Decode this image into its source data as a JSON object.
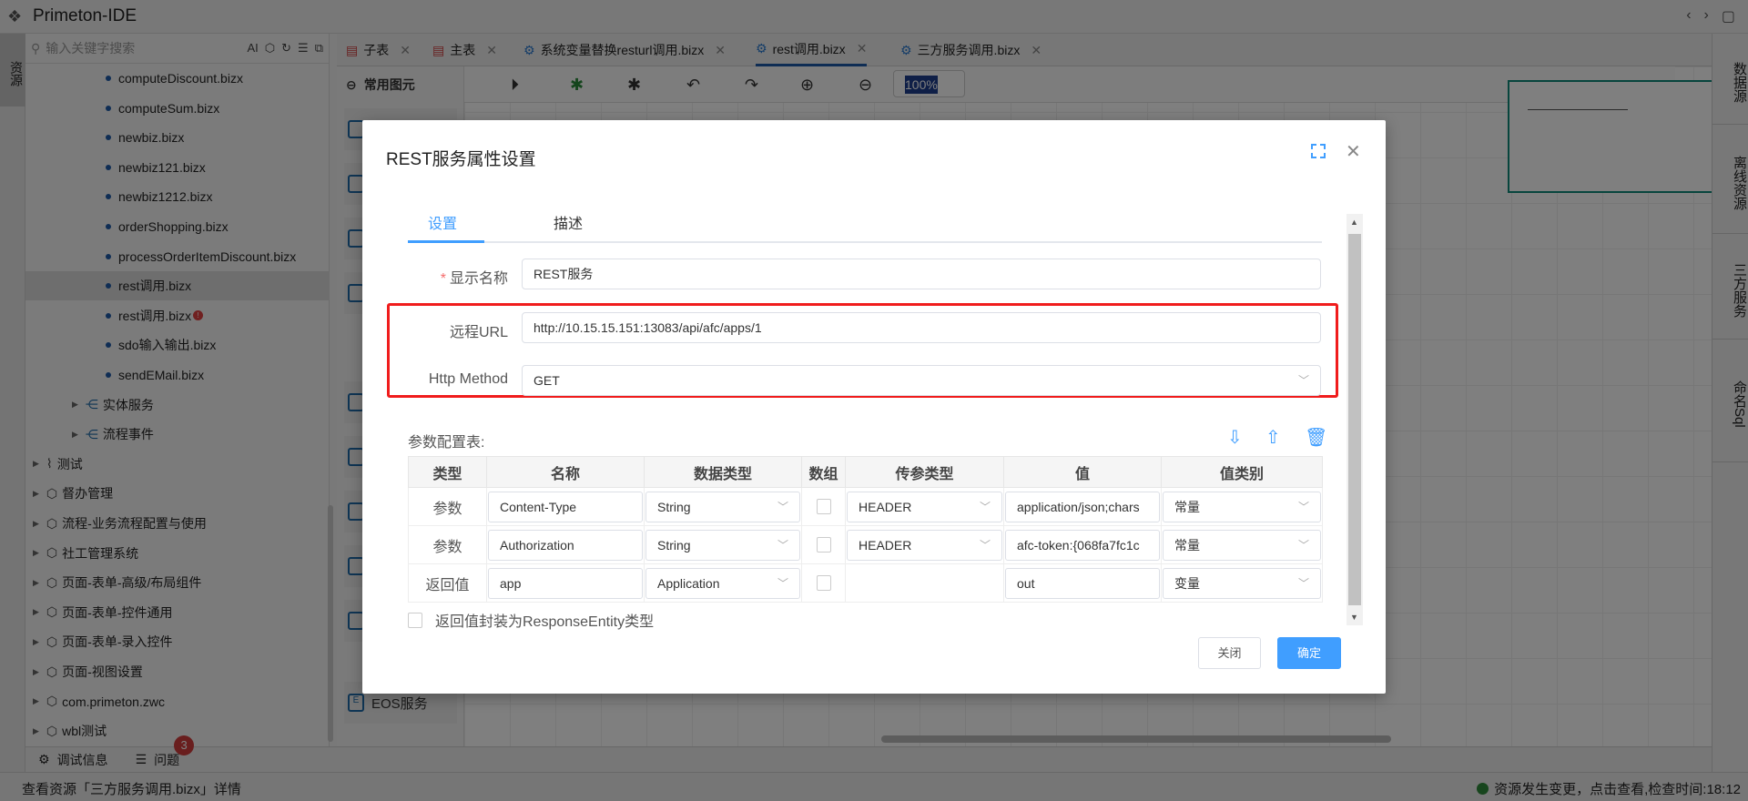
{
  "app": {
    "title": "Primeton-IDE"
  },
  "left_strip": {
    "label": "资源"
  },
  "sidebar": {
    "search_placeholder": "输入关键字搜索",
    "tools": [
      "AI",
      "⬡",
      "↻",
      "☰",
      "⧉"
    ],
    "items": [
      {
        "label": "computeDiscount.bizx",
        "level": 2,
        "kind": "file"
      },
      {
        "label": "computeSum.bizx",
        "level": 2,
        "kind": "file"
      },
      {
        "label": "newbiz.bizx",
        "level": 2,
        "kind": "file"
      },
      {
        "label": "newbiz121.bizx",
        "level": 2,
        "kind": "file"
      },
      {
        "label": "newbiz1212.bizx",
        "level": 2,
        "kind": "file"
      },
      {
        "label": "orderShopping.bizx",
        "level": 2,
        "kind": "file"
      },
      {
        "label": "processOrderItemDiscount.bizx",
        "level": 2,
        "kind": "file"
      },
      {
        "label": "rest调用.bizx",
        "level": 2,
        "kind": "file",
        "selected": true
      },
      {
        "label": "rest调用.bizx",
        "level": 2,
        "kind": "file",
        "error": "!"
      },
      {
        "label": "sdo输入输出.bizx",
        "level": 2,
        "kind": "file"
      },
      {
        "label": "sendEMail.bizx",
        "level": 2,
        "kind": "file"
      },
      {
        "label": "实体服务",
        "level": 1,
        "kind": "group"
      },
      {
        "label": "流程事件",
        "level": 1,
        "kind": "group"
      },
      {
        "label": "测试",
        "level": 0,
        "kind": "test"
      },
      {
        "label": "督办管理",
        "level": 0,
        "kind": "pkg"
      },
      {
        "label": "流程-业务流程配置与使用",
        "level": 0,
        "kind": "pkg"
      },
      {
        "label": "社工管理系统",
        "level": 0,
        "kind": "pkg"
      },
      {
        "label": "页面-表单-高级/布局组件",
        "level": 0,
        "kind": "pkg"
      },
      {
        "label": "页面-表单-控件通用",
        "level": 0,
        "kind": "pkg"
      },
      {
        "label": "页面-表单-录入控件",
        "level": 0,
        "kind": "pkg"
      },
      {
        "label": "页面-视图设置",
        "level": 0,
        "kind": "pkg"
      },
      {
        "label": "com.primeton.zwc",
        "level": 0,
        "kind": "pkg"
      },
      {
        "label": "wbl测试",
        "level": 0,
        "kind": "pkg"
      }
    ]
  },
  "tabs": [
    {
      "label": "子表",
      "icon": "form-icon"
    },
    {
      "label": "主表",
      "icon": "form-icon"
    },
    {
      "label": "系统变量替换resturl调用.bizx",
      "icon": "gear-icon"
    },
    {
      "label": "rest调用.bizx",
      "icon": "gear-icon",
      "active": true
    },
    {
      "label": "三方服务调用.bizx",
      "icon": "gear-icon"
    }
  ],
  "palette": {
    "header": "常用图元",
    "eos": "EOS服务"
  },
  "toolbar": {
    "zoom": "100%"
  },
  "right_strip": [
    "数据源",
    "离线资源",
    "三方服务",
    "命名Sql"
  ],
  "bottom": {
    "debug": "调试信息",
    "problems": "问题",
    "problems_count": "3"
  },
  "status": {
    "left": "查看资源「三方服务调用.bizx」详情",
    "right": "资源发生变更，点击查看,检查时间:18:12"
  },
  "modal": {
    "title": "REST服务属性设置",
    "tabs": [
      "设置",
      "描述"
    ],
    "display_name_label": "显示名称",
    "display_name": "REST服务",
    "url_label": "远程URL",
    "url": "http://10.15.15.151:13083/api/afc/apps/1",
    "method_label": "Http Method",
    "method": "GET",
    "params_title": "参数配置表:",
    "columns": [
      "类型",
      "名称",
      "数据类型",
      "数组",
      "传参类型",
      "值",
      "值类别"
    ],
    "rows": [
      {
        "type": "参数",
        "name": "Content-Type",
        "dtype": "String",
        "pass": "HEADER",
        "value": "application/json;chars",
        "vtype": "常量"
      },
      {
        "type": "参数",
        "name": "Authorization",
        "dtype": "String",
        "pass": "HEADER",
        "value": "afc-token:{068fa7fc1c",
        "vtype": "常量"
      },
      {
        "type": "返回值",
        "name": "app",
        "dtype": "Application",
        "pass": "",
        "value": "out",
        "vtype": "变量"
      }
    ],
    "wrap_label": "返回值封装为ResponseEntity类型",
    "close": "关闭",
    "ok": "确定"
  }
}
